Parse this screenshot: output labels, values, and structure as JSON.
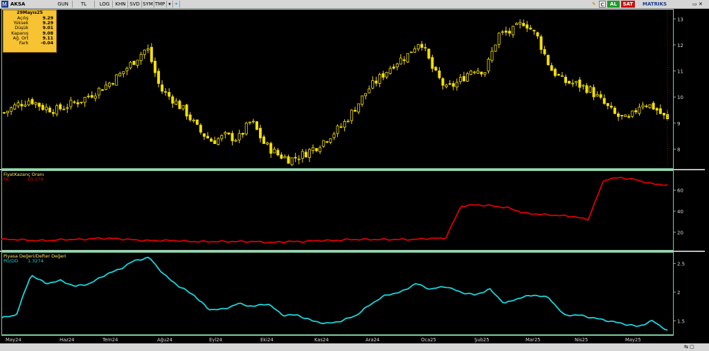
{
  "app": {
    "symbol": "AKSA",
    "brand": "MATRIKS"
  },
  "toolbar": {
    "buttons": [
      "GUN",
      "TL",
      "LOG",
      "KHN",
      "SVD",
      "SYM",
      "TMP"
    ],
    "al_label": "AL",
    "sat_label": "SAT",
    "c_label": "C"
  },
  "info_box": {
    "date": "29Mayıs25",
    "rows": [
      {
        "k": "Açılış",
        "v": "9.29"
      },
      {
        "k": "Yüksek",
        "v": "9.29"
      },
      {
        "k": "Düşük",
        "v": "9.01"
      },
      {
        "k": "Kapanış",
        "v": "9.08"
      },
      {
        "k": "Ağ. Ort",
        "v": "9.11"
      },
      {
        "k": "Fark",
        "v": "-0.04"
      }
    ]
  },
  "panels": {
    "pe_title": "FiyatKazanç Oranı",
    "pe_series_label": "FK",
    "pe_value": "65.276",
    "pb_title": "Piyasa Değeri/Defter Değeri",
    "pb_series_label": "PD/DD",
    "pb_value": "1.3274"
  },
  "colors": {
    "candles": "#f5e000",
    "pe": "#e00000",
    "pb": "#18d8e0",
    "border": "#7fd0a0"
  },
  "chart_data": [
    {
      "type": "candlestick",
      "title": "AKSA",
      "ylim": [
        7.4,
        13.3
      ],
      "y_ticks": [
        "13",
        "12",
        "11",
        "10",
        "9",
        "8"
      ],
      "x": [
        "May24",
        "Haz24",
        "Tem24",
        "Ağu24",
        "Eyl24",
        "Eki24",
        "Kas24",
        "Ara24",
        "Oca25",
        "Şub25",
        "Mar25",
        "Nis25",
        "May25"
      ],
      "close_trajectory": [
        9.4,
        9.7,
        9.9,
        9.6,
        9.5,
        9.7,
        9.9,
        10.2,
        10.5,
        10.9,
        11.4,
        11.9,
        10.3,
        9.9,
        9.4,
        8.7,
        8.3,
        8.5,
        8.4,
        9.1,
        8.2,
        7.8,
        7.6,
        7.8,
        8.1,
        8.5,
        8.9,
        9.6,
        10.3,
        10.8,
        11.3,
        11.6,
        12.2,
        11.0,
        10.3,
        10.6,
        11.1,
        11.0,
        12.4,
        12.5,
        12.9,
        12.3,
        11.1,
        10.6,
        10.5,
        10.3,
        9.8,
        9.3,
        9.1,
        9.8,
        9.6,
        9.1
      ]
    },
    {
      "type": "line",
      "title": "FiyatKazanç Oranı",
      "series": [
        {
          "name": "FK",
          "values": [
            13,
            13,
            12,
            12,
            13,
            13,
            14,
            14,
            13,
            12,
            12,
            12,
            11,
            11,
            11,
            11,
            11,
            10,
            11,
            11,
            12,
            12,
            13,
            13,
            13,
            13,
            13,
            14,
            14,
            45,
            46,
            45,
            43,
            38,
            37,
            36,
            35,
            32,
            70,
            72,
            70,
            66,
            65
          ]
        }
      ],
      "ylim": [
        5,
        75
      ],
      "y_ticks": [
        "60",
        "40",
        "20"
      ]
    },
    {
      "type": "line",
      "title": "Piyasa Değeri/Defter Değeri",
      "series": [
        {
          "name": "PD/DD",
          "values": [
            1.55,
            1.6,
            2.3,
            2.15,
            2.2,
            2.1,
            2.15,
            2.3,
            2.4,
            2.55,
            2.6,
            2.3,
            2.1,
            1.95,
            1.7,
            1.7,
            1.8,
            1.75,
            1.8,
            1.6,
            1.6,
            1.5,
            1.45,
            1.5,
            1.6,
            1.8,
            1.95,
            2.0,
            2.15,
            2.05,
            2.1,
            2.0,
            1.95,
            2.05,
            1.8,
            1.9,
            1.95,
            1.9,
            1.6,
            1.6,
            1.55,
            1.5,
            1.45,
            1.4,
            1.5,
            1.33
          ]
        }
      ],
      "ylim": [
        1.3,
        2.65
      ],
      "y_ticks": [
        "2.5",
        "2",
        "1.5"
      ]
    }
  ]
}
